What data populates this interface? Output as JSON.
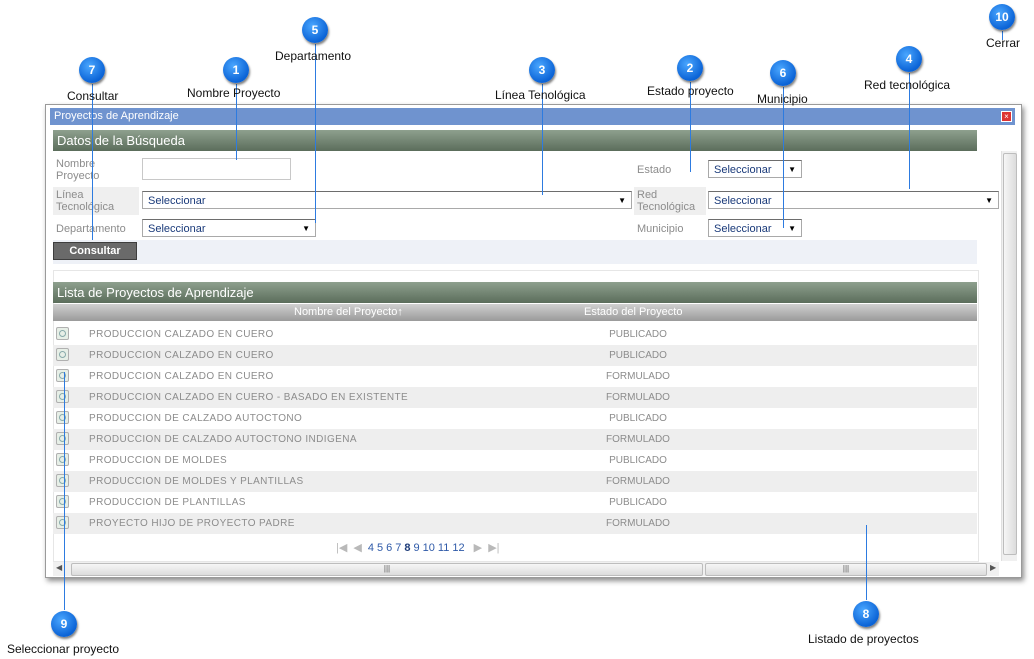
{
  "window": {
    "title": "Proyectos de Aprendizaje",
    "close_icon": "close-icon",
    "close_color": "#d33333",
    "titlebar_color": "#6f93cf"
  },
  "search": {
    "section_title": "Datos de la Búsqueda",
    "nombre_label": "Nombre Proyecto",
    "nombre_value": "",
    "estado_label": "Estado",
    "estado_value": "Seleccionar",
    "linea_label": "Línea Tecnológica",
    "linea_value": "Seleccionar",
    "red_label": "Red Tecnológica",
    "red_value": "Seleccionar",
    "departamento_label": "Departamento",
    "departamento_value": "Seleccionar",
    "municipio_label": "Municipio",
    "municipio_value": "Seleccionar",
    "consultar_label": "Consultar"
  },
  "list": {
    "section_title": "Lista de Proyectos de Aprendizaje",
    "columns": [
      "Nombre del Proyecto↑",
      "Estado del Proyecto"
    ],
    "rows": [
      {
        "name": "PRODUCCION CALZADO EN CUERO",
        "state": "PUBLICADO"
      },
      {
        "name": "PRODUCCION CALZADO EN CUERO",
        "state": "PUBLICADO"
      },
      {
        "name": "PRODUCCION CALZADO EN CUERO",
        "state": "FORMULADO"
      },
      {
        "name": "PRODUCCION CALZADO EN CUERO - BASADO EN EXISTENTE",
        "state": "FORMULADO"
      },
      {
        "name": "PRODUCCION DE CALZADO AUTOCTONO",
        "state": "PUBLICADO"
      },
      {
        "name": "PRODUCCION DE CALZADO AUTOCTONO INDIGENA",
        "state": "FORMULADO"
      },
      {
        "name": "PRODUCCION DE MOLDES",
        "state": "PUBLICADO"
      },
      {
        "name": "PRODUCCION DE MOLDES Y PLANTILLAS",
        "state": "FORMULADO"
      },
      {
        "name": "PRODUCCION DE PLANTILLAS",
        "state": "PUBLICADO"
      },
      {
        "name": "PROYECTO HIJO DE PROYECTO PADRE",
        "state": "FORMULADO"
      }
    ],
    "pager": {
      "pages": [
        "4",
        "5",
        "6",
        "7",
        "8",
        "9",
        "10",
        "11",
        "12"
      ],
      "current": "8"
    }
  },
  "callouts": [
    {
      "num": "1",
      "label": "Nombre Proyecto"
    },
    {
      "num": "2",
      "label": "Estado proyecto"
    },
    {
      "num": "3",
      "label": "Línea Tenológica"
    },
    {
      "num": "4",
      "label": "Red tecnológica"
    },
    {
      "num": "5",
      "label": "Departamento"
    },
    {
      "num": "6",
      "label": "Municipio"
    },
    {
      "num": "7",
      "label": "Consultar"
    },
    {
      "num": "8",
      "label": "Listado de proyectos"
    },
    {
      "num": "9",
      "label": "Seleccionar proyecto"
    },
    {
      "num": "10",
      "label": "Cerrar"
    }
  ],
  "colors": {
    "callout": "#0b63d6",
    "section_header": "#5b6d5b"
  }
}
